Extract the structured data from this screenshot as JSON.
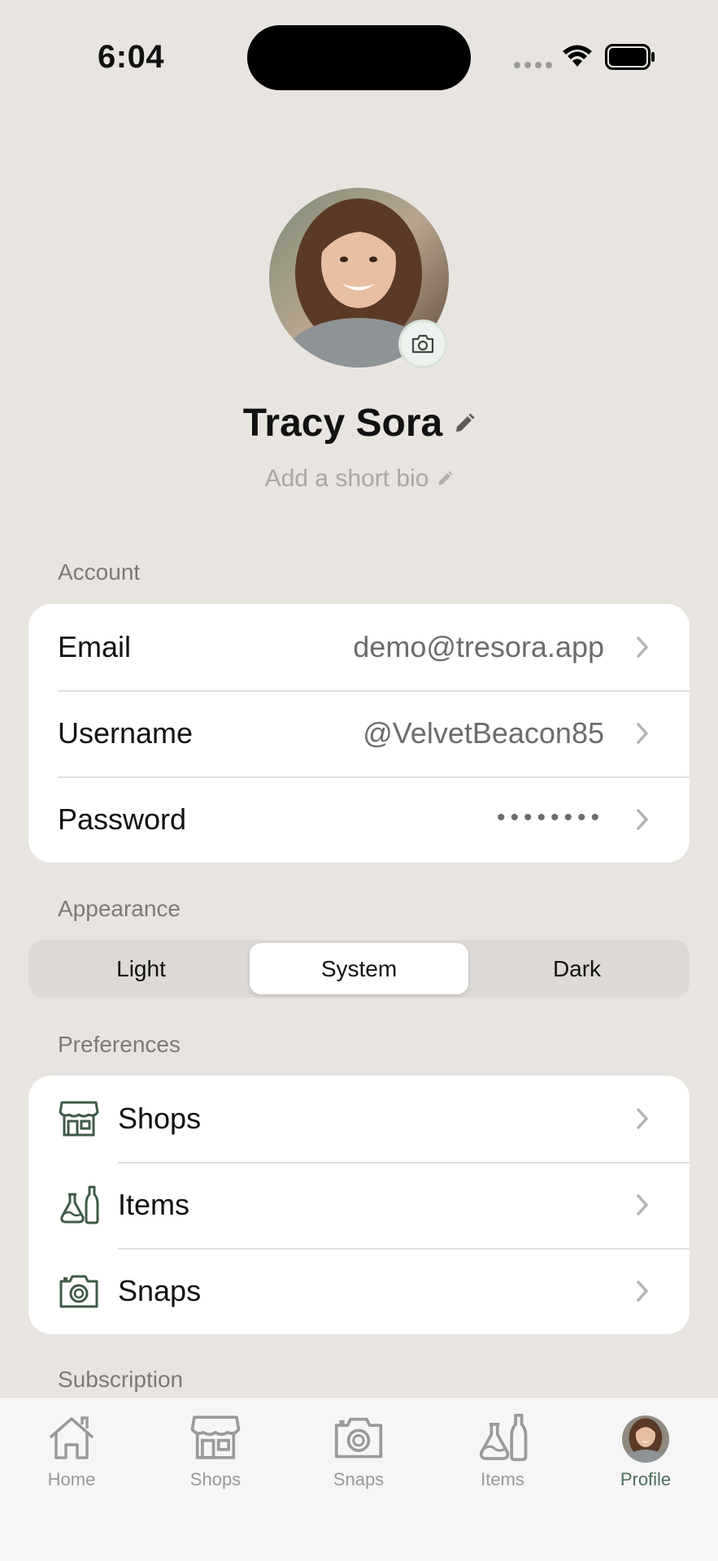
{
  "status_bar": {
    "time": "6:04"
  },
  "profile": {
    "name": "Tracy Sora",
    "bio_placeholder": "Add a short bio"
  },
  "account": {
    "section_label": "Account",
    "rows": [
      {
        "label": "Email",
        "value": "demo@tresora.app"
      },
      {
        "label": "Username",
        "value": "@VelvetBeacon85"
      },
      {
        "label": "Password",
        "value": "••••••••"
      }
    ]
  },
  "appearance": {
    "section_label": "Appearance",
    "options": [
      "Light",
      "System",
      "Dark"
    ],
    "selected": "System"
  },
  "preferences": {
    "section_label": "Preferences",
    "rows": [
      {
        "label": "Shops",
        "icon": "storefront-icon"
      },
      {
        "label": "Items",
        "icon": "items-icon"
      },
      {
        "label": "Snaps",
        "icon": "camera-icon"
      }
    ]
  },
  "subscription": {
    "section_label": "Subscription"
  },
  "tab_bar": {
    "tabs": [
      {
        "label": "Home",
        "icon": "home-icon"
      },
      {
        "label": "Shops",
        "icon": "storefront-icon"
      },
      {
        "label": "Snaps",
        "icon": "camera-icon"
      },
      {
        "label": "Items",
        "icon": "items-icon"
      },
      {
        "label": "Profile",
        "icon": "avatar"
      }
    ],
    "active": "Profile"
  },
  "colors": {
    "background": "#E8E5E1",
    "accent": "#4E6E5B",
    "secondary_text": "#6E6C6A"
  }
}
